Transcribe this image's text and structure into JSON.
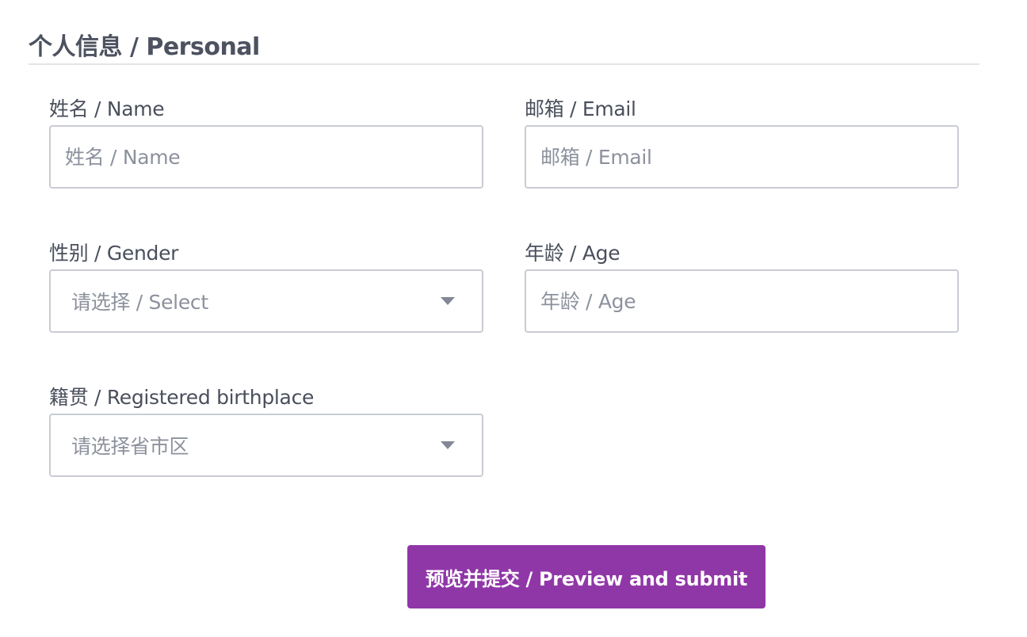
{
  "section": {
    "title": "个人信息 / Personal"
  },
  "fields": {
    "name": {
      "label": "姓名 / Name",
      "placeholder": "姓名 / Name",
      "value": ""
    },
    "email": {
      "label": "邮箱 / Email",
      "placeholder": "邮箱 / Email",
      "value": ""
    },
    "gender": {
      "label": "性别 / Gender",
      "selected": "请选择 / Select"
    },
    "age": {
      "label": "年龄 / Age",
      "placeholder": "年龄 / Age",
      "value": ""
    },
    "birthplace": {
      "label": "籍贯 / Registered birthplace",
      "selected": "请选择省市区"
    }
  },
  "actions": {
    "submit_label": "预览并提交 / Preview and submit"
  },
  "colors": {
    "accent": "#9037a8",
    "border": "#c9ccd3",
    "label_text": "#4a4f5c",
    "placeholder_text": "#8c919d",
    "divider": "#e2e4e8"
  },
  "icons": {
    "select_caret": "chevron-down-icon"
  }
}
